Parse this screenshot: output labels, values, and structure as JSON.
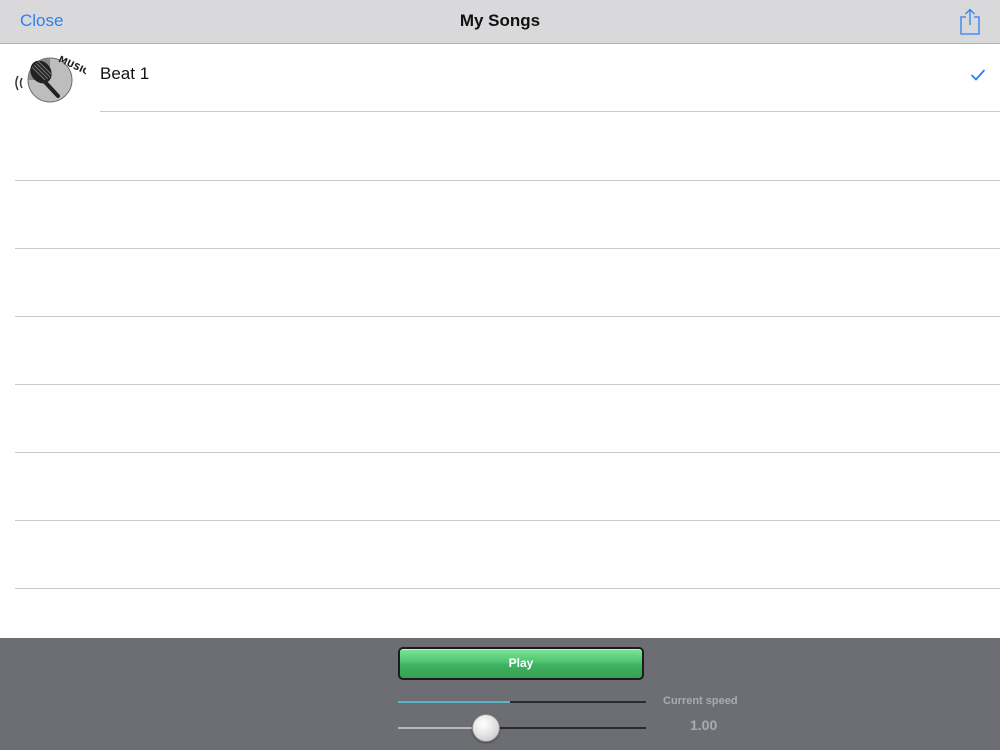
{
  "nav": {
    "close_label": "Close",
    "title": "My Songs",
    "share_icon": "share-icon"
  },
  "songs": [
    {
      "title": "Beat 1",
      "thumb_text": "MUSIC",
      "selected": true
    }
  ],
  "empty_rows": 8,
  "player": {
    "play_label": "Play",
    "progress": 0.45,
    "speed_position": 0.35,
    "speed_label": "Current speed",
    "speed_value": "1.00"
  },
  "colors": {
    "accent": "#2f80ed",
    "navbar_bg": "#d9d9dc",
    "toolbar_bg": "#6d6e73",
    "play_green": "#4dc46f",
    "progress_fill": "#5ab4c9"
  }
}
